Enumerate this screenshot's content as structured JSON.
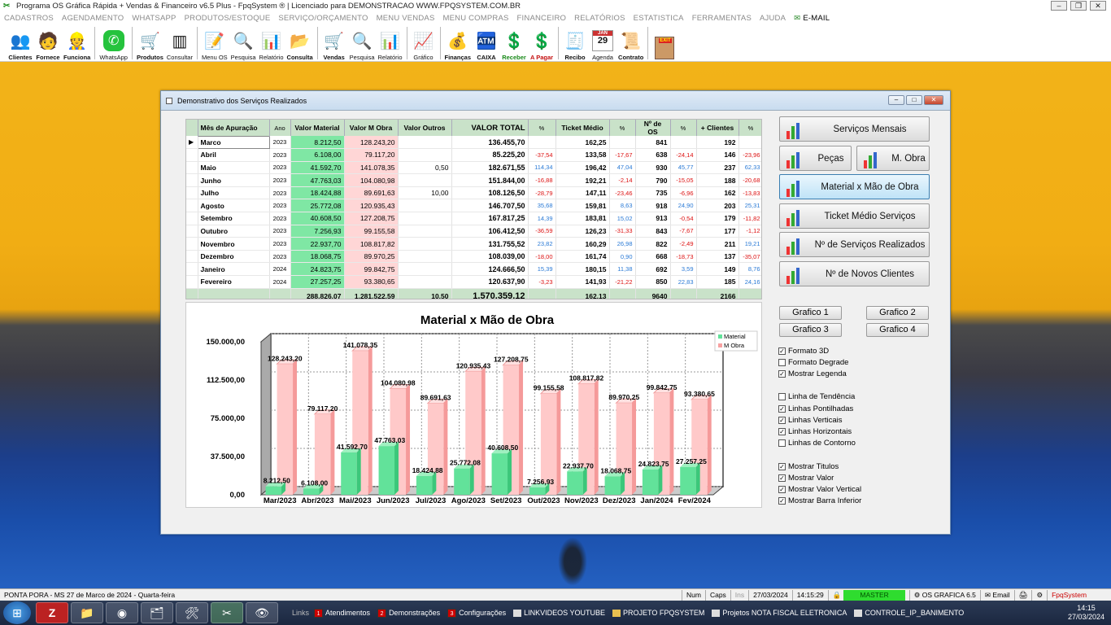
{
  "app_title": "Programa OS Gráfica Rápida + Vendas & Financeiro v6.5 Plus - FpqSystem ® | Licenciado para  DEMONSTRACAO WWW.FPQSYSTEM.COM.BR",
  "menu": [
    "CADASTROS",
    "AGENDAMENTO",
    "WHATSAPP",
    "PRODUTOS/ESTOQUE",
    "SERVIÇO/ORÇAMENTO",
    "MENU VENDAS",
    "MENU COMPRAS",
    "FINANCEIRO",
    "RELATÓRIOS",
    "ESTATISTICA",
    "FERRAMENTAS",
    "AJUDA"
  ],
  "menu_email": "E-MAIL",
  "toolbar": {
    "clientes": "Clientes",
    "fornece": "Fornece",
    "funciona": "Funciona",
    "whatsapp": "WhatsApp",
    "produtos": "Produtos",
    "consultar": "Consultar",
    "menu_os": "Menu OS",
    "pesquisa1": "Pesquisa",
    "relatorio1": "Relatório",
    "consulta": "Consulta",
    "vendas": "Vendas",
    "pesquisa2": "Pesquisa",
    "relatorio2": "Relatório",
    "grafico": "Gráfico",
    "financas": "Finanças",
    "caixa": "CAIXA",
    "receber": "Receber",
    "apagar": "A Pagar",
    "recibo": "Recibo",
    "agenda": "Agenda",
    "contrato": "Contrato",
    "agenda_month": "JAN",
    "agenda_day": "29",
    "exit_tag": "EXIT"
  },
  "window_title": "Demonstrativo dos Serviços Realizados",
  "table": {
    "headers": [
      "Mês de Apuração",
      "Ano",
      "Valor Material",
      "Valor M Obra",
      "Valor Outros",
      "VALOR TOTAL",
      "%",
      "Ticket Médio",
      "%",
      "Nº de OS",
      "%",
      "+ Clientes",
      "%"
    ],
    "current_indicator": "▶",
    "rows": [
      {
        "mes": "Marco",
        "ano": "2023",
        "mat": "8.212,50",
        "obr": "128.243,20",
        "out": "",
        "tot": "136.455,70",
        "p1": "",
        "tk": "162,25",
        "p2": "",
        "os": "841",
        "p3": "",
        "cl": "192",
        "p4": ""
      },
      {
        "mes": "Abril",
        "ano": "2023",
        "mat": "6.108,00",
        "obr": "79.117,20",
        "out": "",
        "tot": "85.225,20",
        "p1": "-37,54",
        "tk": "133,58",
        "p2": "-17,67",
        "os": "638",
        "p3": "-24,14",
        "cl": "146",
        "p4": "-23,96"
      },
      {
        "mes": "Maio",
        "ano": "2023",
        "mat": "41.592,70",
        "obr": "141.078,35",
        "out": "0,50",
        "tot": "182.671,55",
        "p1": "114,34",
        "tk": "196,42",
        "p2": "47,04",
        "os": "930",
        "p3": "45,77",
        "cl": "237",
        "p4": "62,33"
      },
      {
        "mes": "Junho",
        "ano": "2023",
        "mat": "47.763,03",
        "obr": "104.080,98",
        "out": "",
        "tot": "151.844,00",
        "p1": "-16,88",
        "tk": "192,21",
        "p2": "-2,14",
        "os": "790",
        "p3": "-15,05",
        "cl": "188",
        "p4": "-20,68"
      },
      {
        "mes": "Julho",
        "ano": "2023",
        "mat": "18.424,88",
        "obr": "89.691,63",
        "out": "10,00",
        "tot": "108.126,50",
        "p1": "-28,79",
        "tk": "147,11",
        "p2": "-23,46",
        "os": "735",
        "p3": "-6,96",
        "cl": "162",
        "p4": "-13,83"
      },
      {
        "mes": "Agosto",
        "ano": "2023",
        "mat": "25.772,08",
        "obr": "120.935,43",
        "out": "",
        "tot": "146.707,50",
        "p1": "35,68",
        "tk": "159,81",
        "p2": "8,63",
        "os": "918",
        "p3": "24,90",
        "cl": "203",
        "p4": "25,31"
      },
      {
        "mes": "Setembro",
        "ano": "2023",
        "mat": "40.608,50",
        "obr": "127.208,75",
        "out": "",
        "tot": "167.817,25",
        "p1": "14,39",
        "tk": "183,81",
        "p2": "15,02",
        "os": "913",
        "p3": "-0,54",
        "cl": "179",
        "p4": "-11,82"
      },
      {
        "mes": "Outubro",
        "ano": "2023",
        "mat": "7.256,93",
        "obr": "99.155,58",
        "out": "",
        "tot": "106.412,50",
        "p1": "-36,59",
        "tk": "126,23",
        "p2": "-31,33",
        "os": "843",
        "p3": "-7,67",
        "cl": "177",
        "p4": "-1,12"
      },
      {
        "mes": "Novembro",
        "ano": "2023",
        "mat": "22.937,70",
        "obr": "108.817,82",
        "out": "",
        "tot": "131.755,52",
        "p1": "23,82",
        "tk": "160,29",
        "p2": "26,98",
        "os": "822",
        "p3": "-2,49",
        "cl": "211",
        "p4": "19,21"
      },
      {
        "mes": "Dezembro",
        "ano": "2023",
        "mat": "18.068,75",
        "obr": "89.970,25",
        "out": "",
        "tot": "108.039,00",
        "p1": "-18,00",
        "tk": "161,74",
        "p2": "0,90",
        "os": "668",
        "p3": "-18,73",
        "cl": "137",
        "p4": "-35,07"
      },
      {
        "mes": "Janeiro",
        "ano": "2024",
        "mat": "24.823,75",
        "obr": "99.842,75",
        "out": "",
        "tot": "124.666,50",
        "p1": "15,39",
        "tk": "180,15",
        "p2": "11,38",
        "os": "692",
        "p3": "3,59",
        "cl": "149",
        "p4": "8,76"
      },
      {
        "mes": "Fevereiro",
        "ano": "2024",
        "mat": "27.257,25",
        "obr": "93.380,65",
        "out": "",
        "tot": "120.637,90",
        "p1": "-3,23",
        "tk": "141,93",
        "p2": "-21,22",
        "os": "850",
        "p3": "22,83",
        "cl": "185",
        "p4": "24,16"
      }
    ],
    "footer": {
      "mat": "288.826,07",
      "obr": "1.281.522,59",
      "out": "10,50",
      "tot": "1.570.359,12",
      "tk": "162,13",
      "os": "9640",
      "cl": "2166"
    }
  },
  "chart_data": {
    "type": "bar",
    "title": "Material x Mão de Obra",
    "categories": [
      "Mar/2023",
      "Abr/2023",
      "Mai/2023",
      "Jun/2023",
      "Jul/2023",
      "Ago/2023",
      "Set/2023",
      "Out/2023",
      "Nov/2023",
      "Dez/2023",
      "Jan/2024",
      "Fev/2024"
    ],
    "series": [
      {
        "name": "Material",
        "color": "#62e29a",
        "values": [
          8212.5,
          6108.0,
          41592.7,
          47763.03,
          18424.88,
          25772.08,
          40608.5,
          7256.93,
          22937.7,
          18068.75,
          24823.75,
          27257.25
        ],
        "labels": [
          "8.212,50",
          "6.108,00",
          "41.592,70",
          "47.763,03",
          "18.424,88",
          "25.772,08",
          "40.608,50",
          "7.256,93",
          "22.937,70",
          "18.068,75",
          "24.823,75",
          "27.257,25"
        ]
      },
      {
        "name": "M Obra",
        "color": "#ffc9c9",
        "values": [
          128243.2,
          79117.2,
          141078.35,
          104080.98,
          89691.63,
          120935.43,
          127208.75,
          99155.58,
          108817.82,
          89970.25,
          99842.75,
          93380.65
        ],
        "labels": [
          "128.243,20",
          "79.117,20",
          "141.078,35",
          "104.080,98",
          "89.691,63",
          "120.935,43",
          "127.208,75",
          "99.155,58",
          "108.817,82",
          "89.970,25",
          "99.842,75",
          "93.380,65"
        ]
      }
    ],
    "yticks": [
      "150.000,00",
      "112.500,00",
      "75.000,00",
      "37.500,00",
      "0,00"
    ],
    "ylim": [
      0,
      150000
    ],
    "legend": "top-right",
    "style": "3d",
    "grid": "dotted vertical and horizontal"
  },
  "side_buttons": {
    "mensais": "Serviços Mensais",
    "pecas": "Peças",
    "mobra": "M. Obra",
    "matmao": "Material x Mão de Obra",
    "ticket": "Ticket Médio Serviços",
    "nserv": "Nº de Serviços Realizados",
    "nclientes": "Nº de Novos Clientes"
  },
  "grafico_buttons": [
    "Grafico 1",
    "Grafico 2",
    "Grafico 3",
    "Grafico 4"
  ],
  "options": [
    {
      "label": "Formato 3D",
      "checked": true
    },
    {
      "label": "Formato Degrade",
      "checked": false
    },
    {
      "label": "Mostrar Legenda",
      "checked": true
    },
    {
      "label": "Linha de Tendência",
      "checked": false
    },
    {
      "label": "Linhas Pontilhadas",
      "checked": true
    },
    {
      "label": "Linhas Verticais",
      "checked": true
    },
    {
      "label": "Linhas Horizontais",
      "checked": true
    },
    {
      "label": "Linhas de Contorno",
      "checked": false
    },
    {
      "label": "Mostrar Titulos",
      "checked": true
    },
    {
      "label": "Mostrar Valor",
      "checked": true
    },
    {
      "label": "Mostrar Valor Vertical",
      "checked": true
    },
    {
      "label": "Mostrar Barra Inferior",
      "checked": true
    }
  ],
  "status": {
    "location": "PONTA PORA - MS 27 de Marco de 2024 - Quarta-feira",
    "num": "Num",
    "caps": "Caps",
    "ins": "Ins",
    "date": "27/03/2024",
    "time": "14:15:29",
    "master": "MASTER",
    "os": "OS GRAFICA 6.5",
    "email": "Email",
    "brand": "FpqSystem"
  },
  "taskbar": {
    "links_label": "Links",
    "items": [
      {
        "t": "1 Atendimentos",
        "kind": "red"
      },
      {
        "t": "2 Demonstrações",
        "kind": "red"
      },
      {
        "t": "3 Configurações",
        "kind": "red"
      },
      {
        "t": "LINKVIDEOS YOUTUBE",
        "kind": "file"
      },
      {
        "t": "PROJETO FPQSYSTEM",
        "kind": "folder"
      },
      {
        "t": "Projetos NOTA FISCAL ELETRONICA",
        "kind": "file"
      },
      {
        "t": "CONTROLE_IP_BANIMENTO",
        "kind": "file"
      }
    ],
    "clock_time": "14:15",
    "clock_date": "27/03/2024"
  }
}
